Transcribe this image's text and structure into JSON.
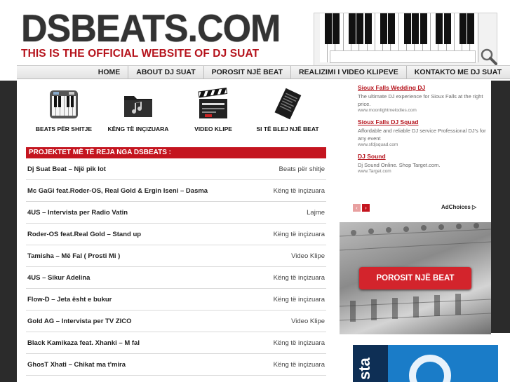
{
  "header": {
    "logo_text": "DSBEATS.COM",
    "tagline": "THIS IS THE OFFICIAL WEBSITE OF DJ SUAT",
    "search_icon": "magnifier-icon"
  },
  "nav": {
    "items": [
      "HOME",
      "ABOUT DJ SUAT",
      "POROSIT NJË BEAT",
      "REALIZIMI I VIDEO KLIPEVE",
      "KONTAKTO ME DJ SUAT"
    ]
  },
  "categories": [
    {
      "label": "BEATS PËR SHITJE",
      "icon": "piano-icon"
    },
    {
      "label": "KËNG TË INÇIZUARA",
      "icon": "music-folder-icon"
    },
    {
      "label": "VIDEO KLIPE",
      "icon": "clapperboard-icon"
    },
    {
      "label": "SI TË BLEJ NJË BEAT",
      "icon": "document-icon"
    }
  ],
  "projects": {
    "header": "PROJEKTET MË TË REJA NGA DSBEATS :",
    "rows": [
      {
        "title": "Dj Suat Beat – Një pik lot",
        "category": "Beats për shitje"
      },
      {
        "title": "Mc GaGi feat.Roder-OS, Real Gold & Ergin Iseni – Dasma",
        "category": "Këng të inçizuara"
      },
      {
        "title": "4US – Intervista per Radio Vatin",
        "category": "Lajme"
      },
      {
        "title": "Roder-OS feat.Real Gold – Stand up",
        "category": "Këng të inçizuara"
      },
      {
        "title": "Tamisha – Më Fal ( Prosti Mi )",
        "category": "Video Klipe"
      },
      {
        "title": "4US – Sikur Adelina",
        "category": "Këng të inçizuara"
      },
      {
        "title": "Flow-D – Jeta ësht e bukur",
        "category": "Këng të inçizuara"
      },
      {
        "title": "Gold AG – Intervista per TV ZICO",
        "category": "Video Klipe"
      },
      {
        "title": "Black Kamikaza feat. Xhanki – M fal",
        "category": "Këng të inçizuara"
      },
      {
        "title": "GhosT Xhati – Chikat ma t'mira",
        "category": "Këng të inçizuara"
      }
    ]
  },
  "ads": {
    "items": [
      {
        "title": "Sioux Falls Wedding DJ",
        "desc": "The ultimate DJ experience for Sioux Falls at the right price.",
        "url": "www.moonlightmelodies.com"
      },
      {
        "title": "Sioux Falls DJ Squad",
        "desc": "Affordable and reliable DJ service Professional DJ's for any event",
        "url": "www.sfdjsquad.com"
      },
      {
        "title": "DJ Sound",
        "desc": "Dj Sound Online. Shop Target.com.",
        "url": "www.Target.com"
      }
    ],
    "adchoices": "AdChoices ▷",
    "prev_arrow": "‹",
    "next_arrow": "›"
  },
  "banner": {
    "button_label": "POROSIT NJË BEAT"
  },
  "bottom_ad": {
    "text": "sta"
  },
  "colors": {
    "accent_red": "#c4151f",
    "dark_band": "#2b2b2b",
    "ad_link": "#b5121b"
  }
}
